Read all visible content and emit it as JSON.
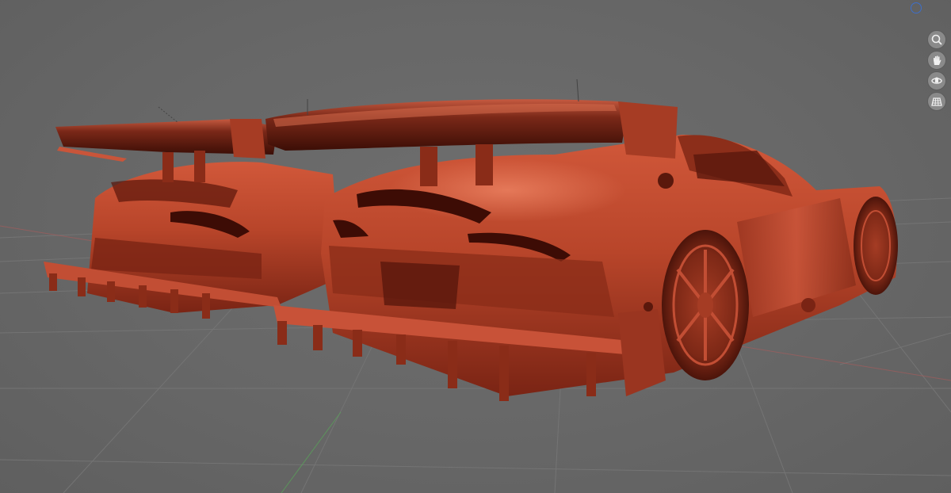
{
  "viewport": {
    "background": "#666666",
    "grid_color": "#747474",
    "x_axis_color": "#b45a5a",
    "y_axis_color": "#5aa05a"
  },
  "model": {
    "body_color": "#b8452a",
    "shade_color": "#4a1208",
    "highlight_color": "#ff9a78"
  },
  "toolbar": {
    "orientation_gizmo_icon": "axis-gizmo-icon",
    "tools": [
      {
        "name": "zoom",
        "icon": "magnifier-icon"
      },
      {
        "name": "pan",
        "icon": "hand-icon"
      },
      {
        "name": "orbit",
        "icon": "orbit-icon"
      },
      {
        "name": "grid",
        "icon": "grid-icon"
      }
    ]
  }
}
